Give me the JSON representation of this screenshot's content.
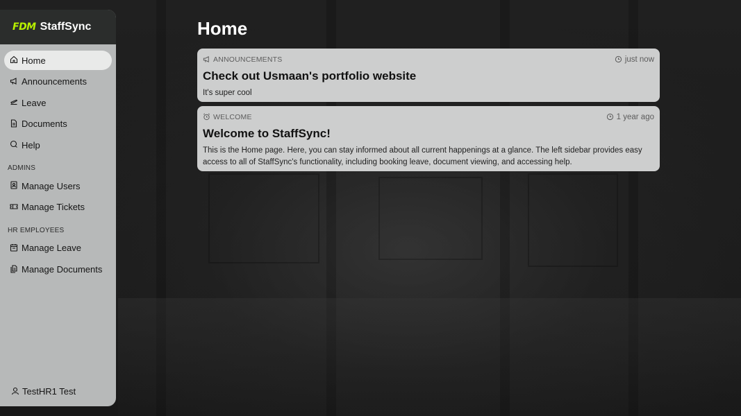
{
  "brand": {
    "logo": "FDM",
    "name": "StaffSync",
    "logo_color": "#b7f000"
  },
  "sidebar": {
    "items": [
      {
        "label": "Home",
        "icon": "home-icon",
        "active": true
      },
      {
        "label": "Announcements",
        "icon": "megaphone-icon"
      },
      {
        "label": "Leave",
        "icon": "plane-icon"
      },
      {
        "label": "Documents",
        "icon": "document-icon"
      },
      {
        "label": "Help",
        "icon": "help-chat-icon"
      }
    ],
    "admins": {
      "label": "ADMINS",
      "items": [
        {
          "label": "Manage Users",
          "icon": "contact-book-icon"
        },
        {
          "label": "Manage Tickets",
          "icon": "ticket-icon"
        }
      ]
    },
    "hr": {
      "label": "HR EMPLOYEES",
      "items": [
        {
          "label": "Manage Leave",
          "icon": "calendar-icon"
        },
        {
          "label": "Manage Documents",
          "icon": "files-icon"
        }
      ]
    },
    "user": {
      "name": "TestHR1 Test",
      "icon": "user-icon"
    }
  },
  "main": {
    "title": "Home",
    "cards": [
      {
        "category": "ANNOUNCEMENTS",
        "category_icon": "megaphone-icon",
        "time": "just now",
        "title": "Check out Usmaan's portfolio website",
        "body": "It's super cool"
      },
      {
        "category": "WELCOME",
        "category_icon": "alarm-clock-icon",
        "time": "1 year ago",
        "title": "Welcome to StaffSync!",
        "body": "This is the Home page. Here, you can stay informed about all current happenings at a glance. The left sidebar provides easy access to all of StaffSync's functionality, including booking leave, document viewing, and accessing help."
      }
    ]
  }
}
